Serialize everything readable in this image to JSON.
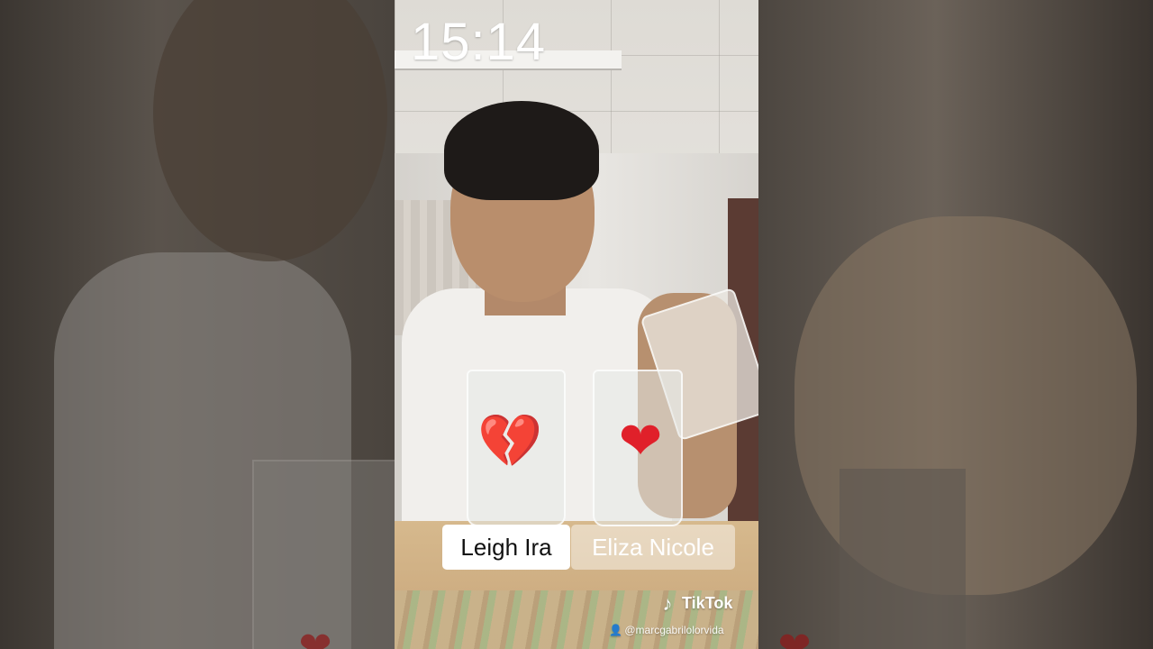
{
  "overlay": {
    "time": "15:14"
  },
  "choices": {
    "left_name": "Leigh Ira",
    "right_name": "Eliza Nicole"
  },
  "icons": {
    "broken_heart": "💔",
    "heart": "❤",
    "tiktok": "♪",
    "user": "👤"
  },
  "watermark": {
    "brand": "TikTok",
    "handle": "@marcgabrilolorvida"
  },
  "colors": {
    "heart_red": "#e0202a"
  }
}
